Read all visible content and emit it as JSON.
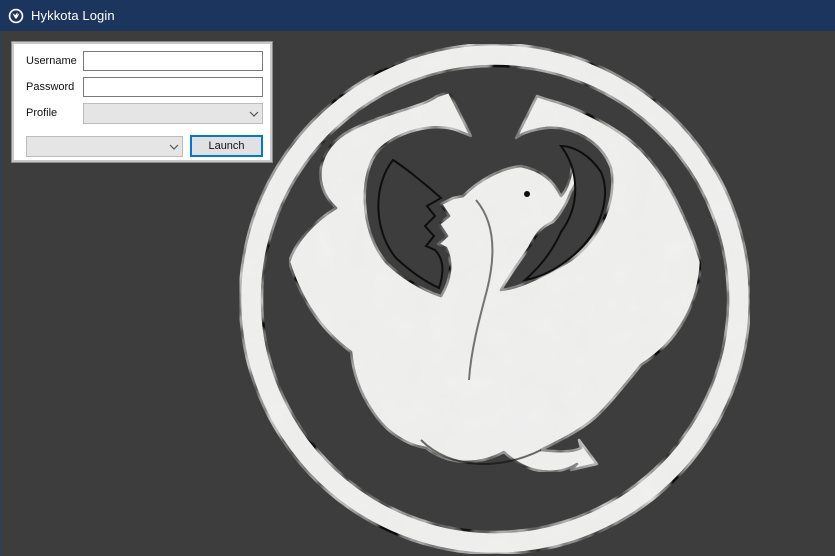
{
  "window": {
    "title": "Hykkota Login",
    "icon": "dragon-logo-icon",
    "titlebar_color": "#1b355c",
    "background_color": "#3d3d3d"
  },
  "login_form": {
    "username_label": "Username",
    "username_value": "",
    "password_label": "Password",
    "password_value": "",
    "profile_label": "Profile",
    "profile_selected": "",
    "secondary_selected": "",
    "launch_label": "Launch",
    "accent_color": "#0078d7"
  },
  "background": {
    "emblem": "dragon-in-circle-emblem",
    "emblem_color": "#ededec"
  }
}
